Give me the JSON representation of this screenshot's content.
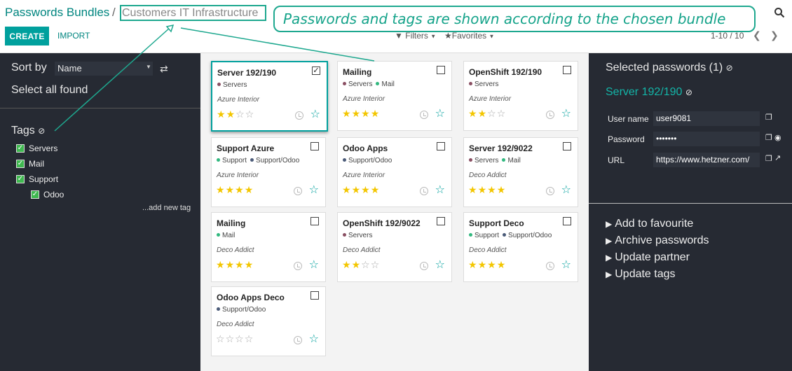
{
  "header": {
    "breadcrumb_root": "Passwords Bundles",
    "breadcrumb_sep": "/",
    "breadcrumb_current": "Customers IT Infrastructure",
    "callout": "Passwords and tags are shown according to the chosen bundle",
    "create_label": "CREATE",
    "import_label": "IMPORT",
    "filters_label": "Filters",
    "favorites_label": "Favorites",
    "pager": "1-10 / 10"
  },
  "left": {
    "sort_label": "Sort by",
    "sort_value": "Name",
    "select_all": "Select all found",
    "tags_title": "Tags",
    "tags": [
      "Servers",
      "Mail",
      "Support",
      "Odoo"
    ],
    "add_tag": "...add new tag"
  },
  "cards": [
    {
      "title": "Server 192/190",
      "tags": [
        {
          "name": "Servers",
          "color": "#8a4f62"
        }
      ],
      "partner": "Azure Interior",
      "stars": 2,
      "checked": true,
      "selected": true
    },
    {
      "title": "Mailing",
      "tags": [
        {
          "name": "Servers",
          "color": "#8a4f62"
        },
        {
          "name": "Mail",
          "color": "#32b87f"
        }
      ],
      "partner": "Azure Interior",
      "stars": 4,
      "checked": false,
      "selected": false
    },
    {
      "title": "OpenShift 192/190",
      "tags": [
        {
          "name": "Servers",
          "color": "#8a4f62"
        }
      ],
      "partner": "Azure Interior",
      "stars": 2,
      "checked": false,
      "selected": false
    },
    {
      "title": "Support Azure",
      "tags": [
        {
          "name": "Support",
          "color": "#32b87f"
        },
        {
          "name": "Support/Odoo",
          "color": "#4a5a78"
        }
      ],
      "partner": "Azure Interior",
      "stars": 4,
      "checked": false,
      "selected": false
    },
    {
      "title": "Odoo Apps",
      "tags": [
        {
          "name": "Support/Odoo",
          "color": "#4a5a78"
        }
      ],
      "partner": "Azure Interior",
      "stars": 4,
      "checked": false,
      "selected": false
    },
    {
      "title": "Server 192/9022",
      "tags": [
        {
          "name": "Servers",
          "color": "#8a4f62"
        },
        {
          "name": "Mail",
          "color": "#32b87f"
        }
      ],
      "partner": "Deco Addict",
      "stars": 4,
      "checked": false,
      "selected": false
    },
    {
      "title": "Mailing",
      "tags": [
        {
          "name": "Mail",
          "color": "#32b87f"
        }
      ],
      "partner": "Deco Addict",
      "stars": 4,
      "checked": false,
      "selected": false
    },
    {
      "title": "OpenShift 192/9022",
      "tags": [
        {
          "name": "Servers",
          "color": "#8a4f62"
        }
      ],
      "partner": "Deco Addict",
      "stars": 2,
      "checked": false,
      "selected": false
    },
    {
      "title": "Support Deco",
      "tags": [
        {
          "name": "Support",
          "color": "#32b87f"
        },
        {
          "name": "Support/Odoo",
          "color": "#4a5a78"
        }
      ],
      "partner": "Deco Addict",
      "stars": 4,
      "checked": false,
      "selected": false
    },
    {
      "title": "Odoo Apps Deco",
      "tags": [
        {
          "name": "Support/Odoo",
          "color": "#4a5a78"
        }
      ],
      "partner": "Deco Addict",
      "stars": 0,
      "checked": false,
      "selected": false
    }
  ],
  "right": {
    "selected_title": "Selected passwords (1)",
    "selected_name": "Server 192/190",
    "username_label": "User name",
    "username_value": "user9081",
    "password_label": "Password",
    "password_value": "•••••••",
    "url_label": "URL",
    "url_value": "https://www.hetzner.com/",
    "actions": [
      "Add to favourite",
      "Archive passwords",
      "Update partner",
      "Update tags"
    ]
  },
  "colors": {
    "accent": "#00a09d",
    "callout": "#1ea88f",
    "panel": "#262a33",
    "star": "#f3c600"
  }
}
